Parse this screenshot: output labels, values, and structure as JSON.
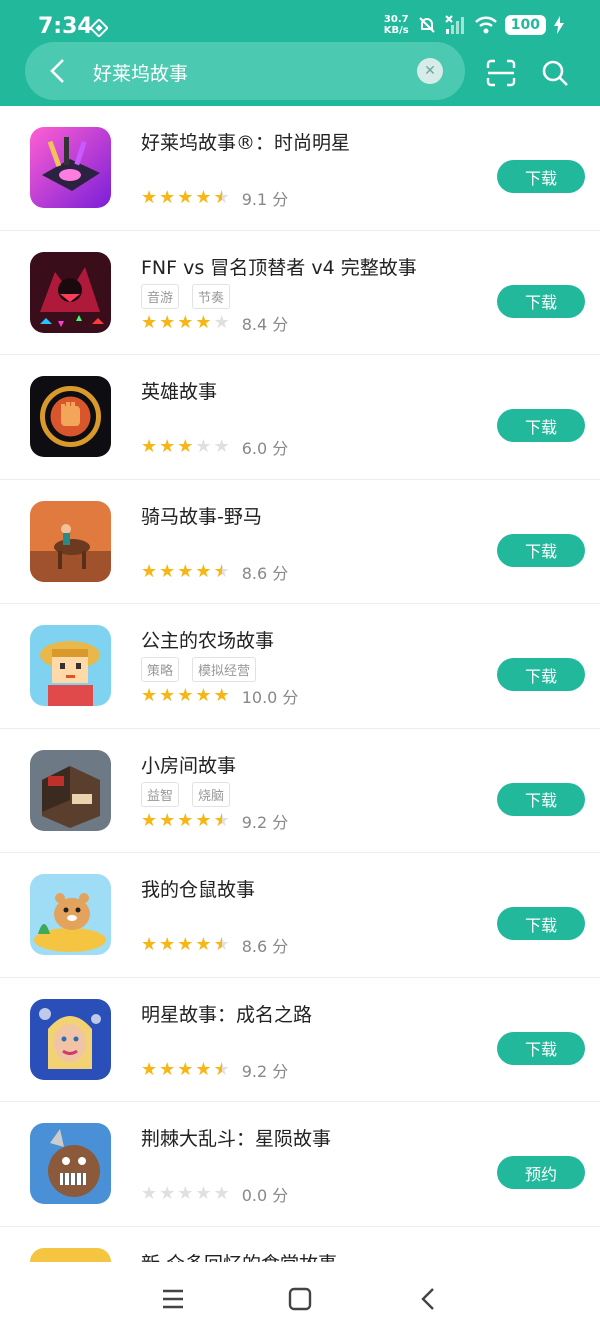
{
  "status_bar": {
    "time": "7:34",
    "net_speed_value": "30.7",
    "net_speed_unit": "KB/s",
    "battery": "100"
  },
  "search": {
    "query": "好莱坞故事"
  },
  "colors": {
    "accent": "#22b89c",
    "star": "#f7b616"
  },
  "apps": [
    {
      "name": "好莱坞故事®：时尚明星",
      "tags": [],
      "stars": 4.5,
      "score": "9.1 分",
      "button": "下载"
    },
    {
      "name": "FNF vs 冒名顶替者 v4 完整故事",
      "tags": [
        "音游",
        "节奏"
      ],
      "stars": 4,
      "score": "8.4 分",
      "button": "下载"
    },
    {
      "name": "英雄故事",
      "tags": [],
      "stars": 3,
      "score": "6.0 分",
      "button": "下载"
    },
    {
      "name": "骑马故事-野马",
      "tags": [],
      "stars": 4.5,
      "score": "8.6 分",
      "button": "下载"
    },
    {
      "name": "公主的农场故事",
      "tags": [
        "策略",
        "模拟经营"
      ],
      "stars": 5,
      "score": "10.0 分",
      "button": "下载"
    },
    {
      "name": "小房间故事",
      "tags": [
        "益智",
        "烧脑"
      ],
      "stars": 4.5,
      "score": "9.2 分",
      "button": "下载"
    },
    {
      "name": "我的仓鼠故事",
      "tags": [],
      "stars": 4.5,
      "score": "8.6 分",
      "button": "下载"
    },
    {
      "name": "明星故事：成名之路",
      "tags": [],
      "stars": 4.5,
      "score": "9.2 分",
      "button": "下载"
    },
    {
      "name": "荆棘大乱斗：星陨故事",
      "tags": [],
      "stars": 0,
      "score": "0.0 分",
      "button": "预约"
    }
  ],
  "partial_app": {
    "name": "新·众多回忆的食堂故事"
  },
  "icons": [
    "back-icon",
    "clear-icon",
    "scan-icon",
    "search-icon",
    "menu-icon",
    "home-icon",
    "nav-back-icon"
  ]
}
